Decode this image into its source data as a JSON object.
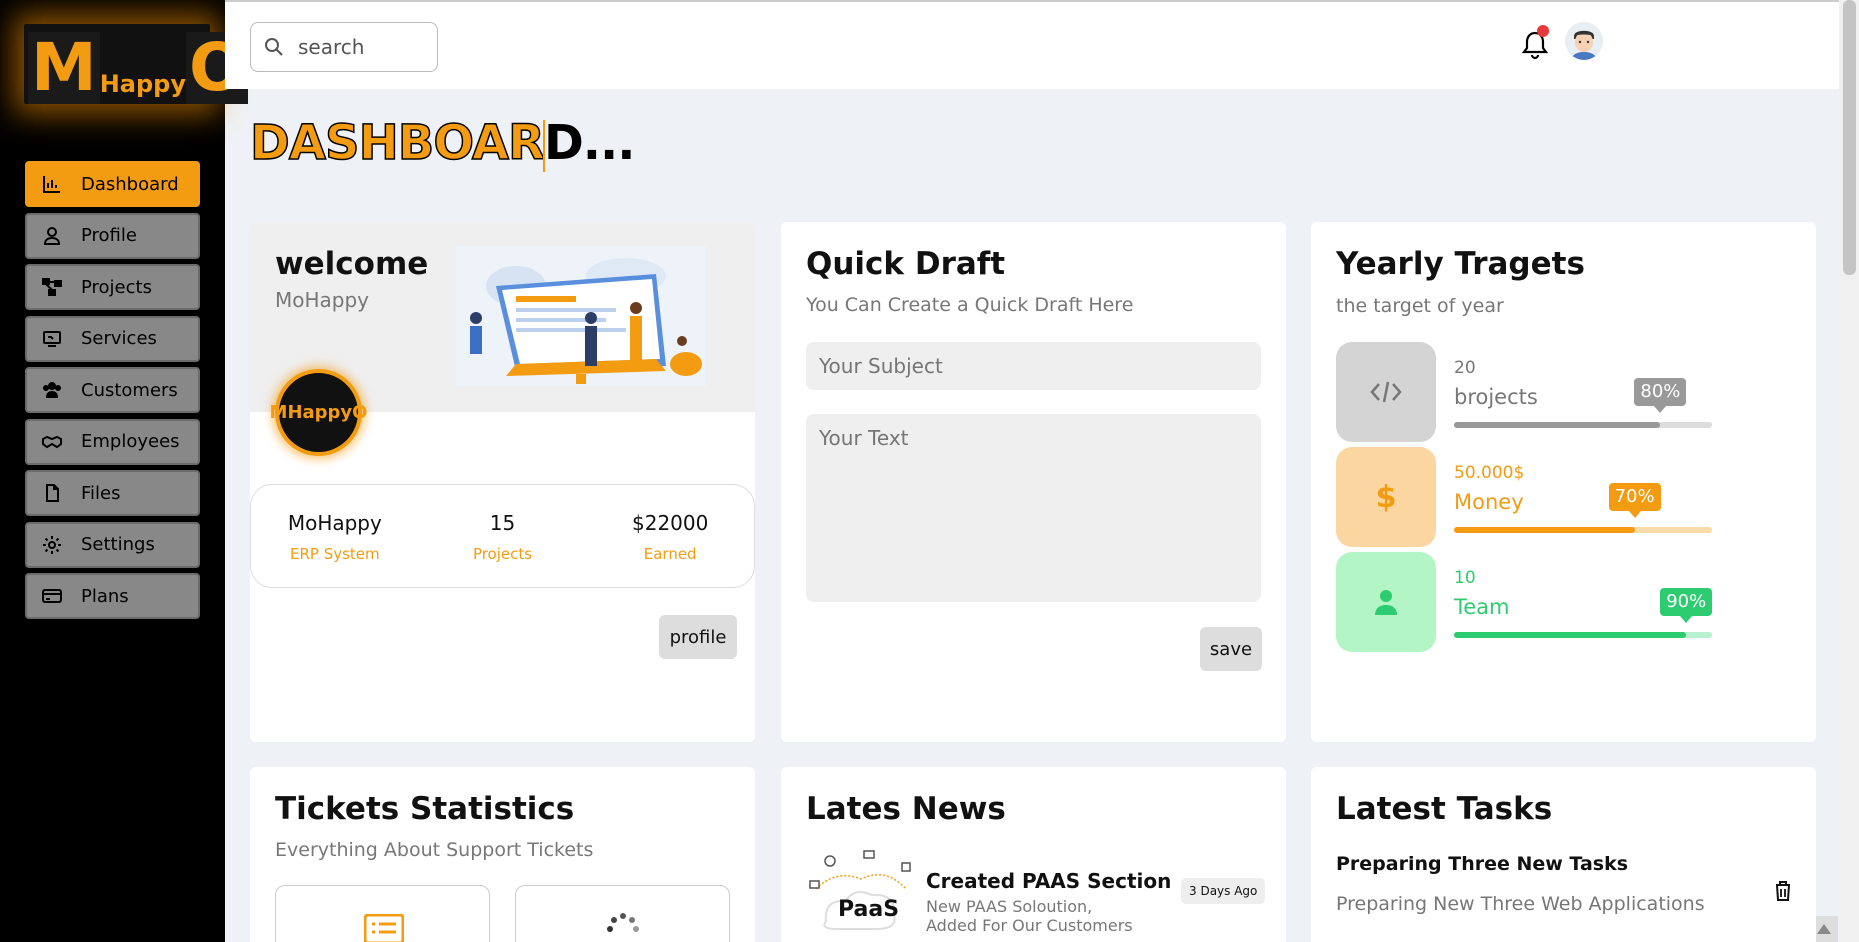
{
  "logo": {
    "left": "M",
    "mid": "Happy",
    "right": "O"
  },
  "sidebar": {
    "items": [
      {
        "label": "Dashboard",
        "icon": "chart-icon",
        "active": true
      },
      {
        "label": "Profile",
        "icon": "user-icon"
      },
      {
        "label": "Projects",
        "icon": "diagram-icon"
      },
      {
        "label": "Services",
        "icon": "monitor-icon"
      },
      {
        "label": "Customers",
        "icon": "users-icon"
      },
      {
        "label": "Employees",
        "icon": "handshake-icon"
      },
      {
        "label": "Files",
        "icon": "file-icon"
      },
      {
        "label": "Settings",
        "icon": "gear-icon"
      },
      {
        "label": "Plans",
        "icon": "credit-card-icon"
      }
    ]
  },
  "header": {
    "search_placeholder": "search"
  },
  "page_title": {
    "orange": "DASHBOAR",
    "black": "D..."
  },
  "welcome": {
    "title": "welcome",
    "name": "MoHappy",
    "avatar_text": "MHappyO",
    "stats": [
      {
        "value": "MoHappy",
        "label": "ERP System"
      },
      {
        "value": "15",
        "label": "Projects"
      },
      {
        "value": "$22000",
        "label": "Earned"
      }
    ],
    "button": "profile"
  },
  "quick_draft": {
    "title": "Quick Draft",
    "subtitle": "You Can Create a Quick Draft Here",
    "subject_placeholder": "Your Subject",
    "text_placeholder": "Your Text",
    "button": "save"
  },
  "targets": {
    "title": "Yearly Tragets",
    "subtitle": "the target of year",
    "items": [
      {
        "value": "20",
        "label": "brojects",
        "percent": 80,
        "percent_label": "80%",
        "color": "#999999",
        "track": "#dddddd",
        "bg": "#d4d4d4",
        "icon": "code-icon"
      },
      {
        "value": "50.000$",
        "label": "Money",
        "percent": 70,
        "percent_label": "70%",
        "color": "#f39c12",
        "track": "#fbdca9",
        "bg": "#fbd6a0",
        "icon": "dollar-icon"
      },
      {
        "value": "10",
        "label": "Team",
        "percent": 90,
        "percent_label": "90%",
        "color": "#2ecc71",
        "track": "#b9f1cf",
        "bg": "#b3f5c4",
        "icon": "user-icon"
      }
    ]
  },
  "tickets": {
    "title": "Tickets Statistics",
    "subtitle": "Everything About Support Tickets"
  },
  "news": {
    "title": "Lates News",
    "item_title": "Created PAAS Section",
    "item_desc": "New PAAS Soloution, Added For Our Customers",
    "item_time": "3 Days Ago",
    "item_image_text": "PaaS"
  },
  "tasks": {
    "title": "Latest Tasks",
    "item_title": "Preparing Three New Tasks",
    "item_desc": "Preparing New Three Web Applications"
  }
}
